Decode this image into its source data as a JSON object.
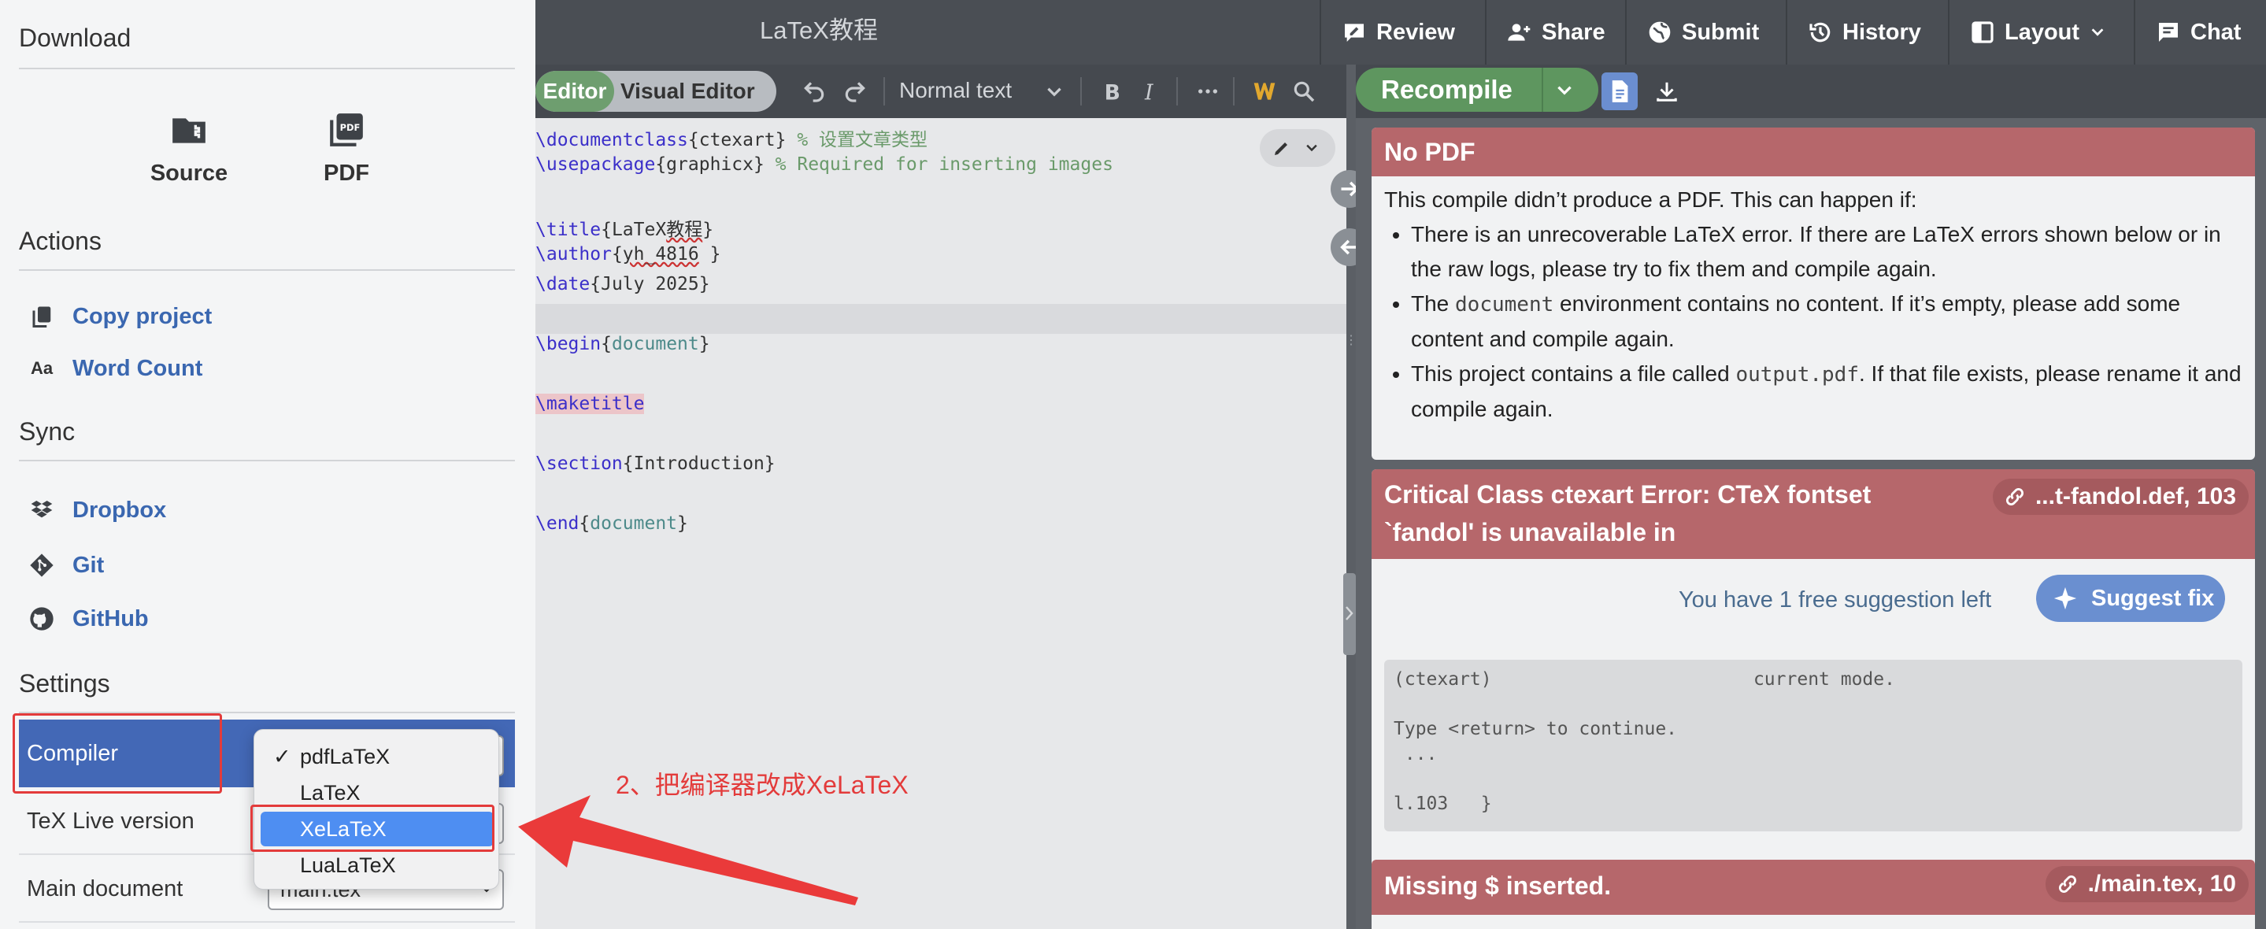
{
  "topbar": {
    "project_title": "LaTeX教程",
    "buttons": {
      "review": "Review",
      "share": "Share",
      "submit": "Submit",
      "history": "History",
      "layout": "Layout",
      "chat": "Chat"
    }
  },
  "editor_toolbar": {
    "editor_tab": "Editor",
    "visual_editor_tab": "Visual Editor",
    "text_style": "Normal text"
  },
  "editor": {
    "lines": {
      "l1_cmd": "\\documentclass",
      "l1_arg": "{ctexart}",
      "l1_comment": " % 设置文章类型",
      "l2_cmd": "\\usepackage",
      "l2_arg": "{graphicx}",
      "l2_comment": " % Required for inserting images",
      "l4_cmd": "\\title",
      "l4_arg": "{LaTeX",
      "l4_squig": "教程",
      "l4_end": "}",
      "l5_cmd": "\\author",
      "l5_arg": "{",
      "l5_squig": "yh_4816",
      "l5_end": " }",
      "l6_cmd": "\\date",
      "l6_arg": "{July 2025}",
      "l8_cmd": "\\begin",
      "l8_open": "{",
      "l8_env": "document",
      "l8_close": "}",
      "l10_cmd": "\\maketitle",
      "l12_cmd": "\\section",
      "l12_arg": "{Introduction}",
      "l14_cmd": "\\end",
      "l14_open": "{",
      "l14_env": "document",
      "l14_close": "}"
    }
  },
  "pdf_toolbar": {
    "recompile": "Recompile"
  },
  "logs": {
    "no_pdf": {
      "title": "No PDF",
      "intro": "This compile didn’t produce a PDF. This can happen if:",
      "b1": "There is an unrecoverable LaTeX error. If there are LaTeX errors shown below or in the raw logs, please try to fix them and compile again.",
      "b2_a": "The ",
      "b2_code": "document",
      "b2_b": " environment contains no content. If it’s empty, please add some content and compile again.",
      "b3_a": "This project contains a file called ",
      "b3_code": "output.pdf",
      "b3_b": ". If that file exists, please rename it and compile again."
    },
    "error1": {
      "title": "Critical Class ctexart Error: CTeX fontset `fandol' is unavailable in",
      "location": "...t-fandol.def, 103",
      "suggest_text": "You have 1 free suggestion left",
      "suggest_button": "Suggest fix",
      "raw_log": "(ctexart)                        current mode.\n\nType <return> to continue.\n ...\n\nl.103   }"
    },
    "error2": {
      "title": "Missing $ inserted.",
      "location": "./main.tex, 10"
    }
  },
  "menu": {
    "download_title": "Download",
    "source_label": "Source",
    "pdf_label": "PDF",
    "actions_title": "Actions",
    "copy_project": "Copy project",
    "word_count": "Word Count",
    "sync_title": "Sync",
    "dropbox": "Dropbox",
    "git": "Git",
    "github": "GitHub",
    "settings_title": "Settings",
    "compiler_label": "Compiler",
    "texlive_label": "TeX Live version",
    "main_doc_label": "Main document",
    "main_doc_value": "main.tex",
    "compiler_options": [
      "pdfLaTeX",
      "LaTeX",
      "XeLaTeX",
      "LuaLaTeX"
    ],
    "compiler_checked": "pdfLaTeX",
    "compiler_highlighted": "XeLaTeX"
  },
  "annotation": {
    "text": "2、把编译器改成XeLaTeX",
    "color": "#e33b3b"
  },
  "colors": {
    "accent_green": "#5e965f",
    "error_header": "#b6676b",
    "link_blue": "#3a67b0",
    "selected_row": "#4368b6",
    "dropdown_highlight": "#4e8ef2"
  }
}
